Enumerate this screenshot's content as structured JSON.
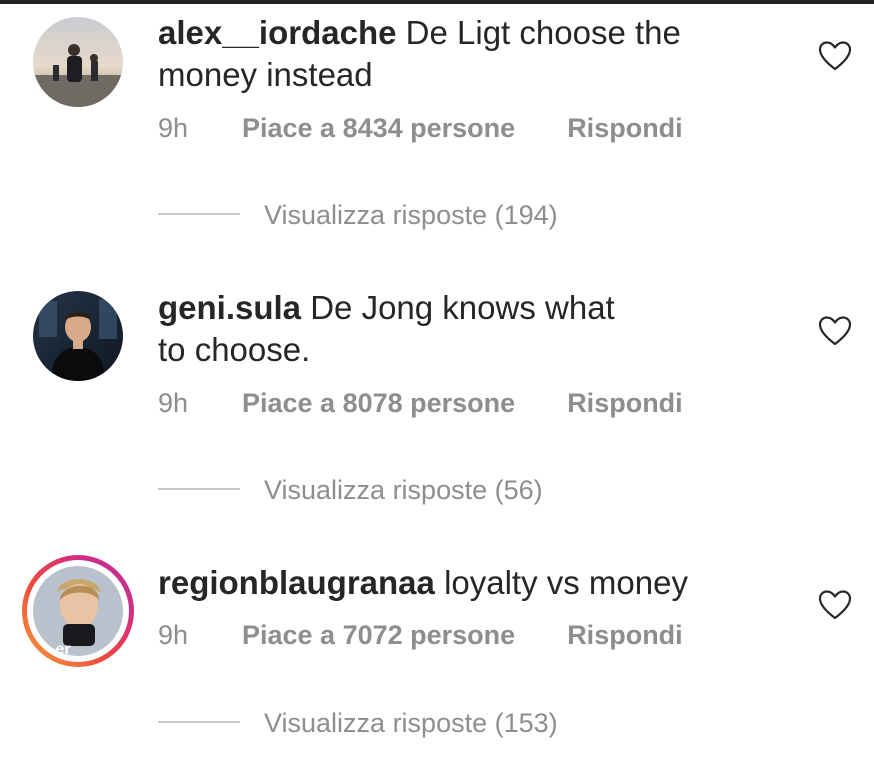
{
  "comments": [
    {
      "username": "alex__iordache",
      "text_line1": "De Ligt choose the",
      "text_line2": "money instead",
      "time": "9h",
      "likes": "Piace a 8434 persone",
      "reply": "Rispondi",
      "view_replies": "Visualizza risposte (194)",
      "avatar_icon": "avatar-photo",
      "has_story": false
    },
    {
      "username": "geni.sula",
      "text_line1": "De Jong knows what",
      "text_line2": "to choose.",
      "time": "9h",
      "likes": "Piace a 8078 persone",
      "reply": "Rispondi",
      "view_replies": "Visualizza risposte (56)",
      "avatar_icon": "avatar-photo",
      "has_story": false
    },
    {
      "username": "regionblaugranaa",
      "text_line1": "loyalty vs money",
      "time": "9h",
      "likes": "Piace a 7072 persone",
      "reply": "Rispondi",
      "view_replies": "Visualizza risposte (153)",
      "avatar_icon": "avatar-photo",
      "has_story": true
    }
  ],
  "colors": {
    "text": "#262626",
    "secondary": "#8e8e8e",
    "divider": "#c7c7c7",
    "story_gradient_start": "#f7a23b",
    "story_gradient_end": "#b42ea4"
  },
  "icons": {
    "like": "heart-outline-icon"
  }
}
